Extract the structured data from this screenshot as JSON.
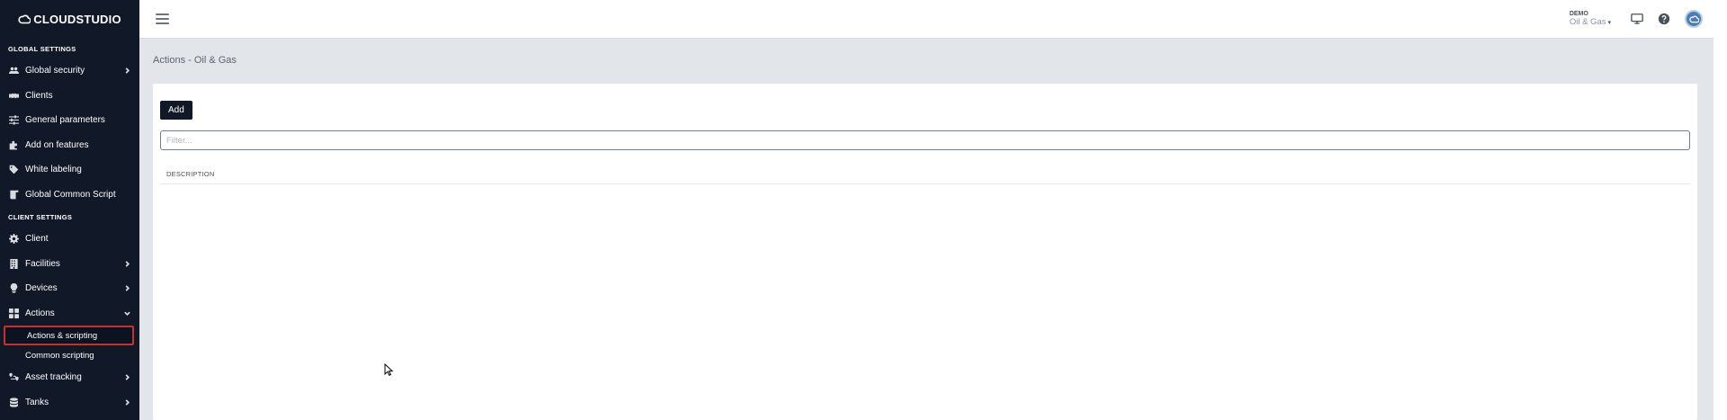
{
  "brand": {
    "logo_text": "CLOUDSTUDIO"
  },
  "sidebar": {
    "global_section": "GLOBAL SETTINGS",
    "global_items": [
      {
        "label": "Global security",
        "icon": "users-icon",
        "has_children": true
      },
      {
        "label": "Clients",
        "icon": "handshake-icon",
        "has_children": false
      },
      {
        "label": "General parameters",
        "icon": "sliders-icon",
        "has_children": false
      },
      {
        "label": "Add on features",
        "icon": "puzzle-icon",
        "has_children": false
      },
      {
        "label": "White labeling",
        "icon": "tag-icon",
        "has_children": false
      },
      {
        "label": "Global Common Script",
        "icon": "scroll-icon",
        "has_children": false
      }
    ],
    "client_section": "CLIENT SETTINGS",
    "client_items": [
      {
        "label": "Client",
        "icon": "gear-icon"
      },
      {
        "label": "Facilities",
        "icon": "building-icon"
      },
      {
        "label": "Devices",
        "icon": "lightbulb-icon"
      },
      {
        "label": "Actions",
        "icon": "grid-icon"
      }
    ],
    "actions_sub": [
      {
        "label": "Actions & scripting",
        "active": true
      },
      {
        "label": "Common scripting",
        "active": false
      }
    ],
    "bottom_items": [
      {
        "label": "Asset tracking",
        "icon": "route-icon"
      },
      {
        "label": "Tanks",
        "icon": "database-icon"
      }
    ]
  },
  "topbar": {
    "org_small": "DEMO",
    "org_name": "Oil & Gas",
    "caret": "▾"
  },
  "main": {
    "page_title": "Actions - Oil & Gas",
    "add_label": "Add",
    "filter_placeholder": "Filter...",
    "columns": [
      "DESCRIPTION"
    ]
  },
  "colors": {
    "sidebar_bg": "#111827",
    "main_bg": "#e2e5ea",
    "highlight": "#c9302c",
    "avatar": "#4a7db7"
  }
}
